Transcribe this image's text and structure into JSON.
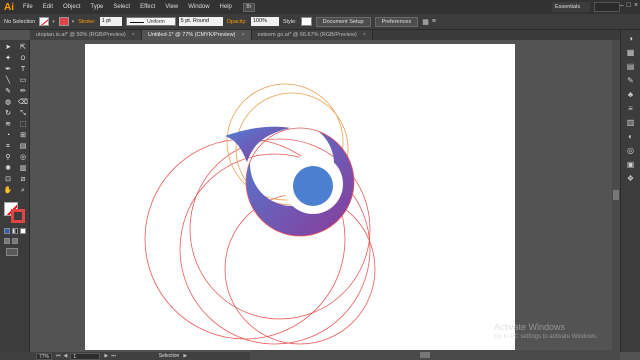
{
  "app": {
    "logo_text": "Ai",
    "menu": [
      "File",
      "Edit",
      "Object",
      "Type",
      "Select",
      "Effect",
      "View",
      "Window",
      "Help"
    ],
    "bridge_label": "Br",
    "workspace": "Essentials"
  },
  "control_bar": {
    "selection_label": "No Selection",
    "stroke_label": "Stroke:",
    "stroke_weight": "1 pt",
    "profile": "Uniform",
    "brush": "5 pt. Round",
    "opacity_label": "Opacity:",
    "opacity_value": "100%",
    "style_label": "Style:",
    "document_setup": "Document Setup",
    "preferences": "Preferences",
    "stroke_color": "#e24545"
  },
  "tabs": [
    {
      "label": "utopian.io.ai* @ 50% (RGB/Preview)",
      "active": false
    },
    {
      "label": "Untitled-1* @ 77% (CMYK/Preview)",
      "active": true
    },
    {
      "label": "esteem go.ai* @ 66.67% (RGB/Preview)",
      "active": false
    }
  ],
  "toolbar": {
    "tools": [
      "selection-tool",
      "direct-selection-tool",
      "magic-wand-tool",
      "lasso-tool",
      "pen-tool",
      "type-tool",
      "line-tool",
      "rectangle-tool",
      "paintbrush-tool",
      "pencil-tool",
      "blob-brush-tool",
      "eraser-tool",
      "rotate-tool",
      "scale-tool",
      "width-tool",
      "free-transform-tool",
      "shape-builder-tool",
      "perspective-grid-tool",
      "mesh-tool",
      "gradient-tool",
      "eyedropper-tool",
      "blend-tool",
      "symbol-sprayer-tool",
      "column-graph-tool",
      "artboard-tool",
      "slice-tool",
      "hand-tool",
      "zoom-tool"
    ],
    "fill_color": "#ffffff",
    "stroke_color": "#e04444"
  },
  "status_bar": {
    "zoom": "77%",
    "artboard_number": "1",
    "tool_name": "Selection"
  },
  "watermark": {
    "title": "Activate Windows",
    "subtitle": "Go to PC settings to activate Windows."
  },
  "artwork": {
    "guide_circle_color": "#e85a5a",
    "orange_circle_color": "#e8a050",
    "gradient_start": "#4f7ed6",
    "gradient_end": "#8a3a98",
    "inner_circle_color": "#4a80cf"
  }
}
